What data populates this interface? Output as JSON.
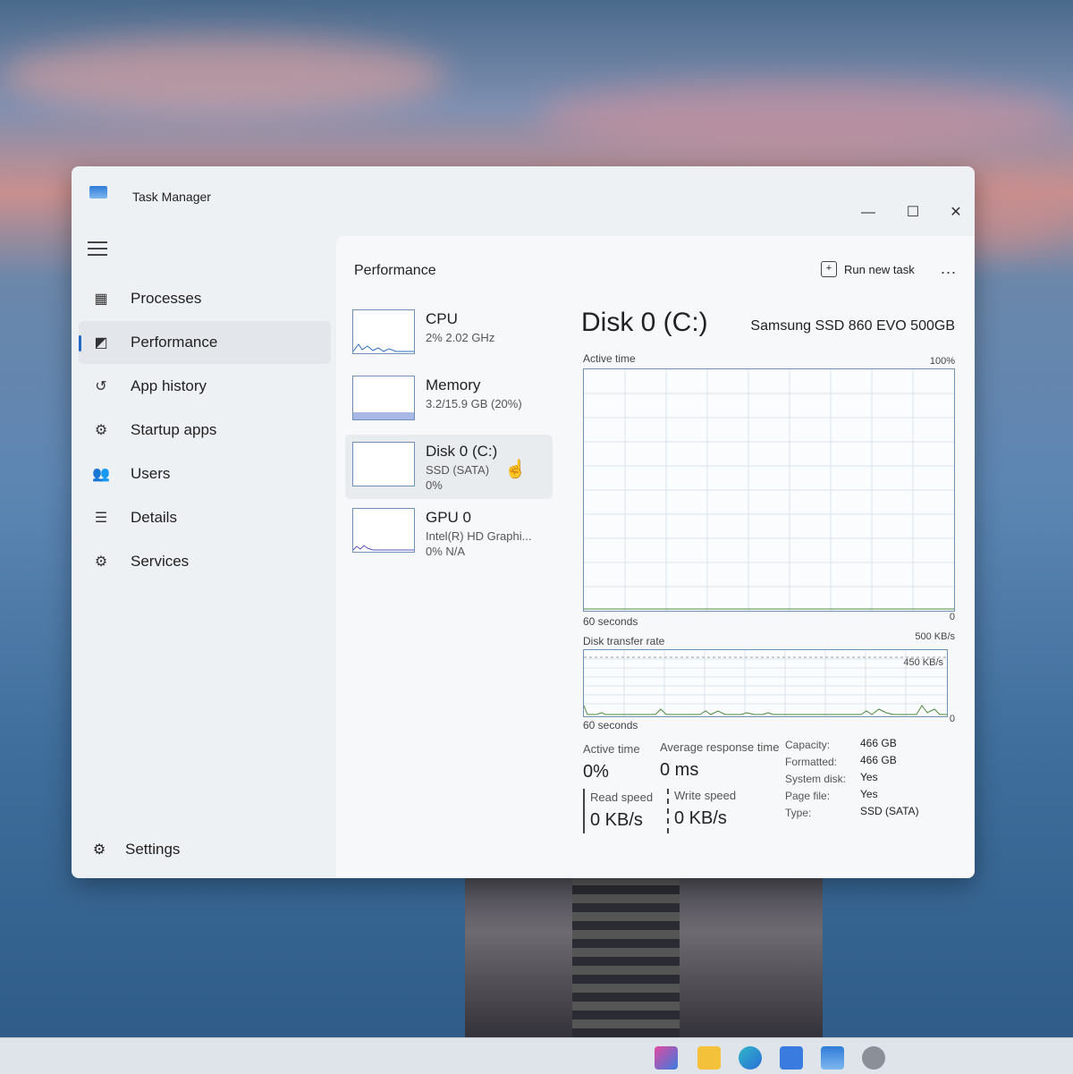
{
  "window": {
    "title": "Task Manager",
    "minimize": "—",
    "maximize": "☐",
    "close": "✕"
  },
  "sidebar": {
    "items": [
      {
        "label": "Processes",
        "icon": "processes-icon",
        "active": false
      },
      {
        "label": "Performance",
        "icon": "performance-icon",
        "active": true
      },
      {
        "label": "App history",
        "icon": "history-icon",
        "active": false
      },
      {
        "label": "Startup apps",
        "icon": "startup-icon",
        "active": false
      },
      {
        "label": "Users",
        "icon": "users-icon",
        "active": false
      },
      {
        "label": "Details",
        "icon": "details-icon",
        "active": false
      },
      {
        "label": "Services",
        "icon": "services-icon",
        "active": false
      }
    ],
    "settings_label": "Settings"
  },
  "header": {
    "title": "Performance",
    "run_new_task": "Run new task",
    "more": "..."
  },
  "resources": [
    {
      "name": "CPU",
      "sub1": "2% 2.02 GHz",
      "sub2": ""
    },
    {
      "name": "Memory",
      "sub1": "3.2/15.9 GB (20%)",
      "sub2": ""
    },
    {
      "name": "Disk 0 (C:)",
      "sub1": "SSD (SATA)",
      "sub2": "0%"
    },
    {
      "name": "GPU 0",
      "sub1": "Intel(R) HD Graphi...",
      "sub2": "0% N/A"
    }
  ],
  "detail": {
    "title": "Disk 0 (C:)",
    "model": "Samsung SSD 860 EVO 500GB",
    "active_time_label": "Active time",
    "active_time_max": "100%",
    "graph1_x_label": "60 seconds",
    "graph1_min": "0",
    "transfer_label": "Disk transfer rate",
    "transfer_max": "500 KB/s",
    "transfer_inner": "450 KB/s",
    "graph2_x_label": "60 seconds",
    "graph2_min": "0"
  },
  "stats": {
    "active_time_label": "Active time",
    "active_time_value": "0%",
    "avg_response_label": "Average response time",
    "avg_response_value": "0 ms",
    "read_label": "Read speed",
    "read_value": "0 KB/s",
    "write_label": "Write speed",
    "write_value": "0 KB/s"
  },
  "properties": [
    {
      "key": "Capacity:",
      "value": "466 GB"
    },
    {
      "key": "Formatted:",
      "value": "466 GB"
    },
    {
      "key": "System disk:",
      "value": "Yes"
    },
    {
      "key": "Page file:",
      "value": "Yes"
    },
    {
      "key": "Type:",
      "value": "SSD (SATA)"
    }
  ]
}
